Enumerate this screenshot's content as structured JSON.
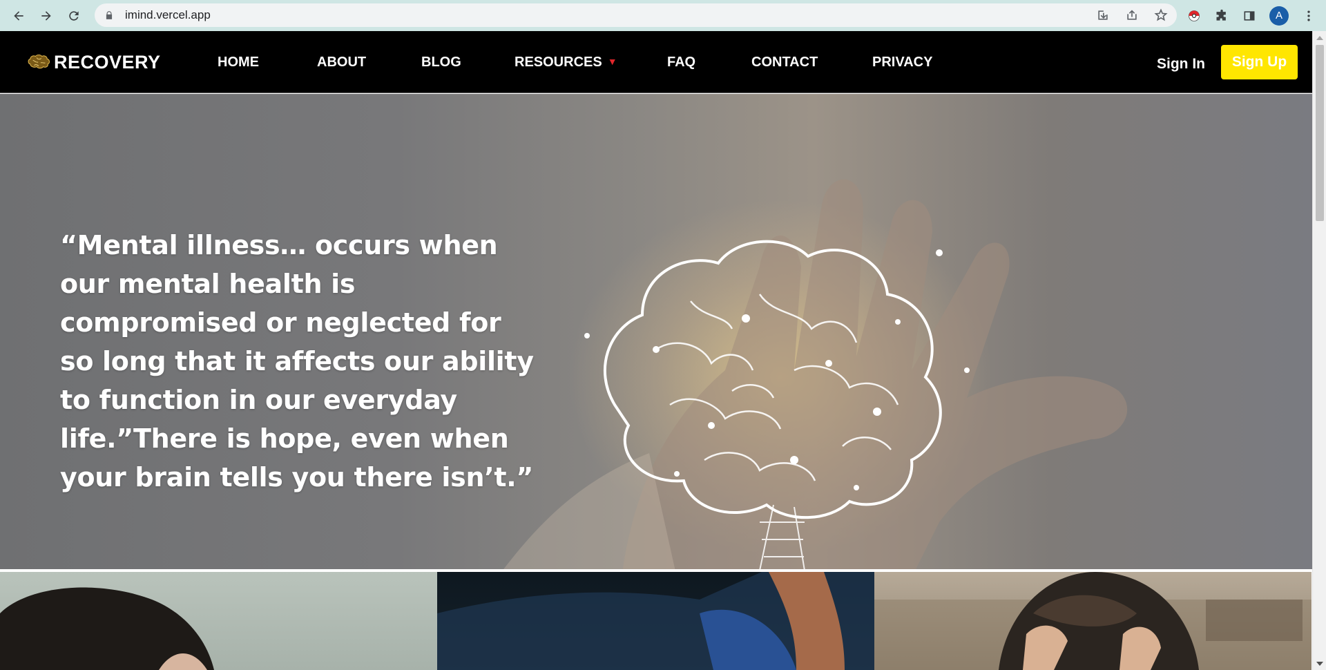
{
  "browser": {
    "url": "imind.vercel.app",
    "profile_initial": "A",
    "icons": [
      "back-arrow-icon",
      "forward-arrow-icon",
      "reload-icon",
      "lock-icon",
      "install-app-icon",
      "share-icon",
      "bookmark-star-icon",
      "pokeball-extension-icon",
      "extensions-puzzle-icon",
      "side-panel-icon",
      "kebab-menu-icon"
    ]
  },
  "site": {
    "logo_text": "RECOVERY",
    "nav": {
      "home": "HOME",
      "about": "ABOUT",
      "blog": "BLOG",
      "resources": "RESOURCES",
      "faq": "FAQ",
      "contact": "CONTACT",
      "privacy": "PRIVACY"
    },
    "sign_in": "Sign In",
    "sign_up": "Sign Up"
  },
  "hero": {
    "quote": "“Mental illness… occurs when our mental health is compromised or neglected for so long that it affects our ability to function in our everyday life.”There is hope, even when your brain tells you there isn’t.”"
  },
  "colors": {
    "header_bg": "#000000",
    "sign_up_bg": "#ffe600",
    "caret": "#e0262b",
    "chrome_bg": "#cfe6e4"
  }
}
